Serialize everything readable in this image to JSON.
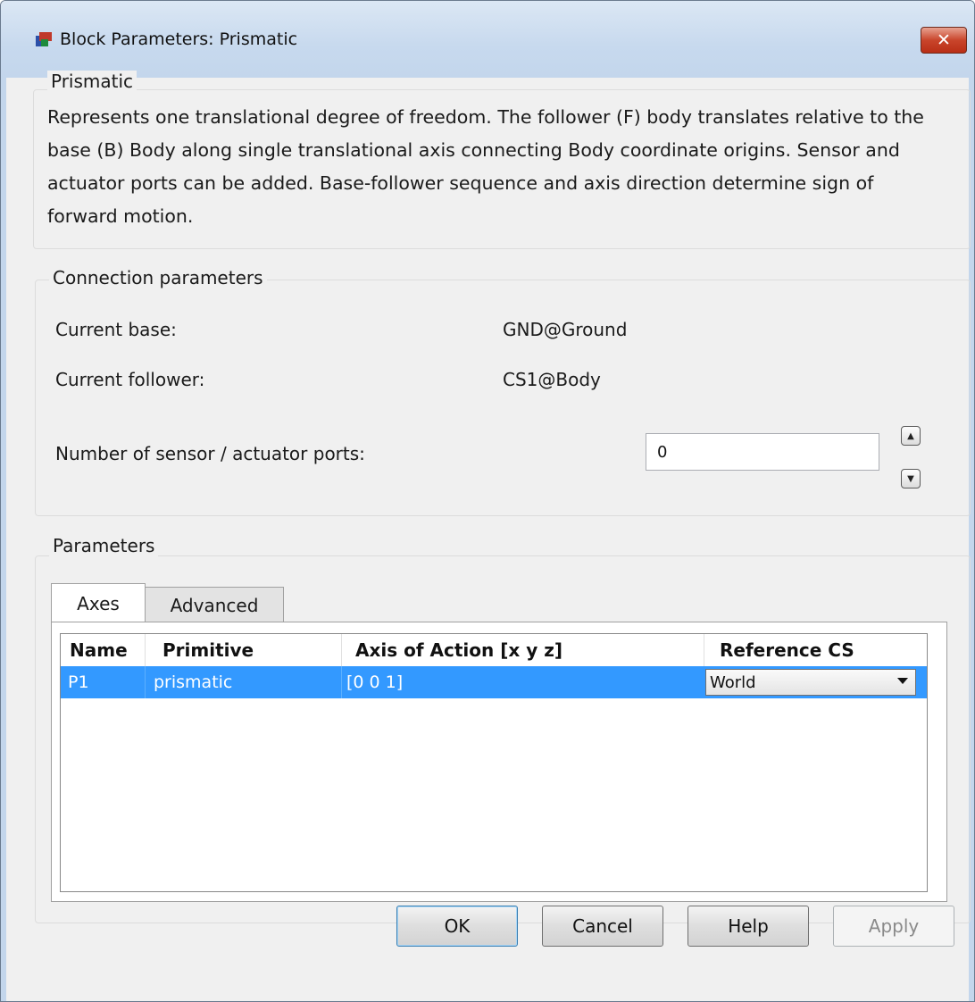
{
  "window": {
    "title": "Block Parameters: Prismatic",
    "close_glyph": "✕"
  },
  "description_group": {
    "title": "Prismatic",
    "text": "Represents one translational degree of freedom. The follower (F) body translates relative to the base (B) Body along single translational axis connecting Body coordinate origins. Sensor and actuator ports can be added. Base-follower sequence and axis direction determine sign of forward motion."
  },
  "connection": {
    "title": "Connection parameters",
    "base_label": "Current base:",
    "base_value": "GND@Ground",
    "follower_label": "Current follower:",
    "follower_value": "CS1@Body",
    "ports_label": "Number of sensor / actuator ports:",
    "ports_value": "0"
  },
  "parameters": {
    "title": "Parameters",
    "tabs": [
      {
        "label": "Axes",
        "active": true
      },
      {
        "label": "Advanced",
        "active": false
      }
    ],
    "table": {
      "headers": [
        "Name",
        "Primitive",
        "Axis of Action [x y z]",
        "Reference CS"
      ],
      "rows": [
        {
          "name": "P1",
          "primitive": "prismatic",
          "axis": "[0 0 1]",
          "reference": "World"
        }
      ]
    }
  },
  "buttons": {
    "ok": "OK",
    "cancel": "Cancel",
    "help": "Help",
    "apply": "Apply"
  },
  "colors": {
    "selection": "#3399ff",
    "titlebar": "#c7d9ee",
    "close": "#c9452b"
  }
}
